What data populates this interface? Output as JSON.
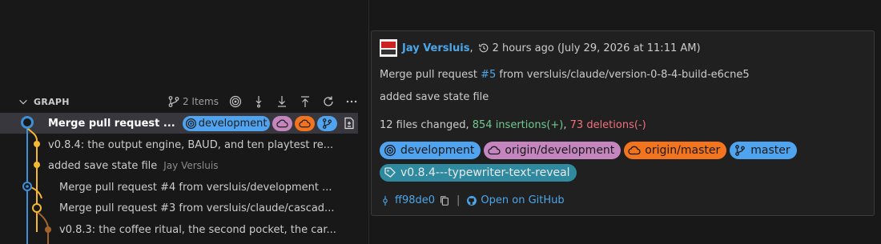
{
  "graph": {
    "title": "GRAPH",
    "items_count": "2 Items"
  },
  "colors": {
    "development": "#4fa3ef",
    "origin_development": "#c586c0",
    "origin_master": "#f2741f",
    "master": "#4fa3ef",
    "tag": "#2f8aa0",
    "rail_yellow": "#f5b82e",
    "rail_blue": "#3d8fd8",
    "rail_brown": "#a0632c"
  },
  "rows": [
    {
      "title": "Merge pull request ...",
      "selected": true
    },
    {
      "title": "v0.8.4: the output engine, BAUD, and ten playtest re..."
    },
    {
      "title": "added save state file",
      "author": "Jay Versluis"
    },
    {
      "title": "Merge pull request #4 from versluis/development ..."
    },
    {
      "title": "Merge pull request #3 from versluis/claude/cascad..."
    },
    {
      "title": "v0.8.3: the coffee ritual, the second pocket, the car..."
    }
  ],
  "row_badge": {
    "label": "development"
  },
  "card": {
    "author": "Jay Versluis",
    "comma": ",",
    "time": "2 hours ago (July 29, 2026 at 11:11 AM)",
    "message_prefix": "Merge pull request ",
    "pr_number": "#5",
    "message_suffix": " from versluis/claude/version-0-8-4-build-e6cne5",
    "body": "added save state file",
    "stats_files": "12 files changed, ",
    "stats_insertions": "854 insertions(+)",
    "stats_sep": ", ",
    "stats_deletions": "73 deletions(-)",
    "badges": {
      "development": "development",
      "origin_development": "origin/development",
      "origin_master": "origin/master",
      "master": "master",
      "tag": "v0.8.4---typewriter-text-reveal"
    },
    "sha": "ff98de0",
    "separator": "|",
    "open_github": "Open on GitHub"
  }
}
